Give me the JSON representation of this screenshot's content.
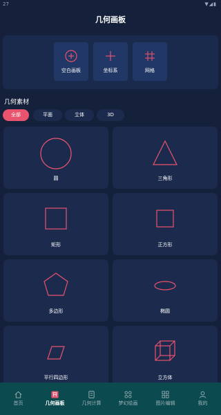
{
  "status": {
    "time": "27",
    "icons": "▼◢▮"
  },
  "app": {
    "title": "几何画板"
  },
  "tools": [
    {
      "label": "空白画板",
      "icon": "plus-circle-icon"
    },
    {
      "label": "坐标系",
      "icon": "plus-icon"
    },
    {
      "label": "网格",
      "icon": "hash-icon"
    }
  ],
  "section": {
    "title": "几何素材"
  },
  "chips": [
    "全部",
    "平面",
    "立体",
    "3D"
  ],
  "active_chip": 0,
  "cards": [
    {
      "label": "圆",
      "icon": "circle-icon"
    },
    {
      "label": "三角形",
      "icon": "triangle-icon"
    },
    {
      "label": "矩形",
      "icon": "rectangle-icon"
    },
    {
      "label": "正方形",
      "icon": "square-icon"
    },
    {
      "label": "多边形",
      "icon": "pentagon-icon"
    },
    {
      "label": "椭圆",
      "icon": "ellipse-icon"
    },
    {
      "label": "平行四边形",
      "icon": "parallelogram-icon"
    },
    {
      "label": "立方体",
      "icon": "cube-icon"
    }
  ],
  "nav": [
    {
      "label": "首页",
      "icon": "home-icon"
    },
    {
      "label": "几何画板",
      "icon": "board-icon"
    },
    {
      "label": "几何计算",
      "icon": "calc-icon"
    },
    {
      "label": "梦幻绘画",
      "icon": "grid-dots-icon"
    },
    {
      "label": "图片编辑",
      "icon": "image-edit-icon"
    },
    {
      "label": "我的",
      "icon": "user-icon"
    }
  ],
  "active_nav": 1,
  "colors": {
    "accent": "#e8536e",
    "background": "#15213a",
    "card": "#1c2b4d",
    "nav_bg": "#0b4a4f"
  }
}
